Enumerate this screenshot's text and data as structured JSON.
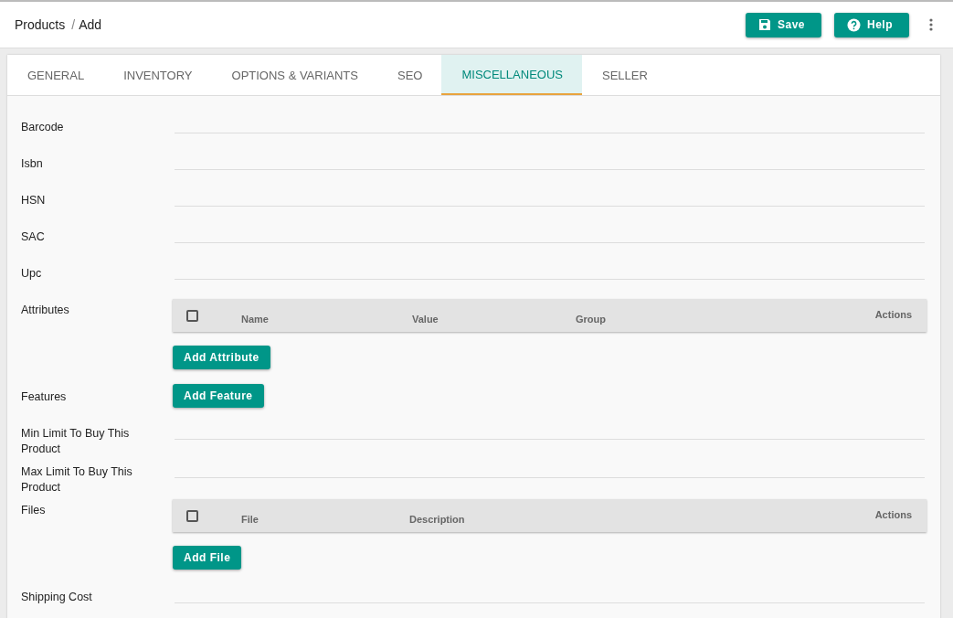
{
  "breadcrumb": [
    "Products",
    "Add"
  ],
  "separator": "/",
  "actions": [
    {
      "label": "Save"
    },
    {
      "label": "Help"
    }
  ],
  "tabs": [
    {
      "label": "GENERAL",
      "selected": false
    },
    {
      "label": "INVENTORY",
      "selected": false
    },
    {
      "label": "OPTIONS & VARIANTS",
      "selected": false
    },
    {
      "label": "SEO",
      "selected": false
    },
    {
      "label": "MISCELLANEOUS",
      "selected": true
    },
    {
      "label": "SELLER",
      "selected": false
    }
  ],
  "fields": [
    {
      "kind": "input",
      "label": "Barcode"
    },
    {
      "kind": "input",
      "label": "Isbn"
    },
    {
      "kind": "input",
      "label": "HSN"
    },
    {
      "kind": "input",
      "label": "SAC"
    },
    {
      "kind": "input",
      "label": "Upc"
    },
    {
      "kind": "table",
      "label": "Attributes",
      "checked": false,
      "columns": [
        "Name",
        "Value",
        "Group"
      ],
      "actions_column": "Actions",
      "button": "Add Attribute"
    },
    {
      "kind": "button",
      "label": "Features",
      "button": "Add Feature"
    },
    {
      "kind": "input",
      "label": "Min Limit To Buy This Product"
    },
    {
      "kind": "input",
      "label": "Max Limit To Buy This Product"
    },
    {
      "kind": "table",
      "label": "Files",
      "checked": false,
      "columns": [
        "File",
        "Description"
      ],
      "actions_column": "Actions",
      "button": "Add File"
    },
    {
      "kind": "input",
      "label": "Shipping Cost"
    }
  ]
}
